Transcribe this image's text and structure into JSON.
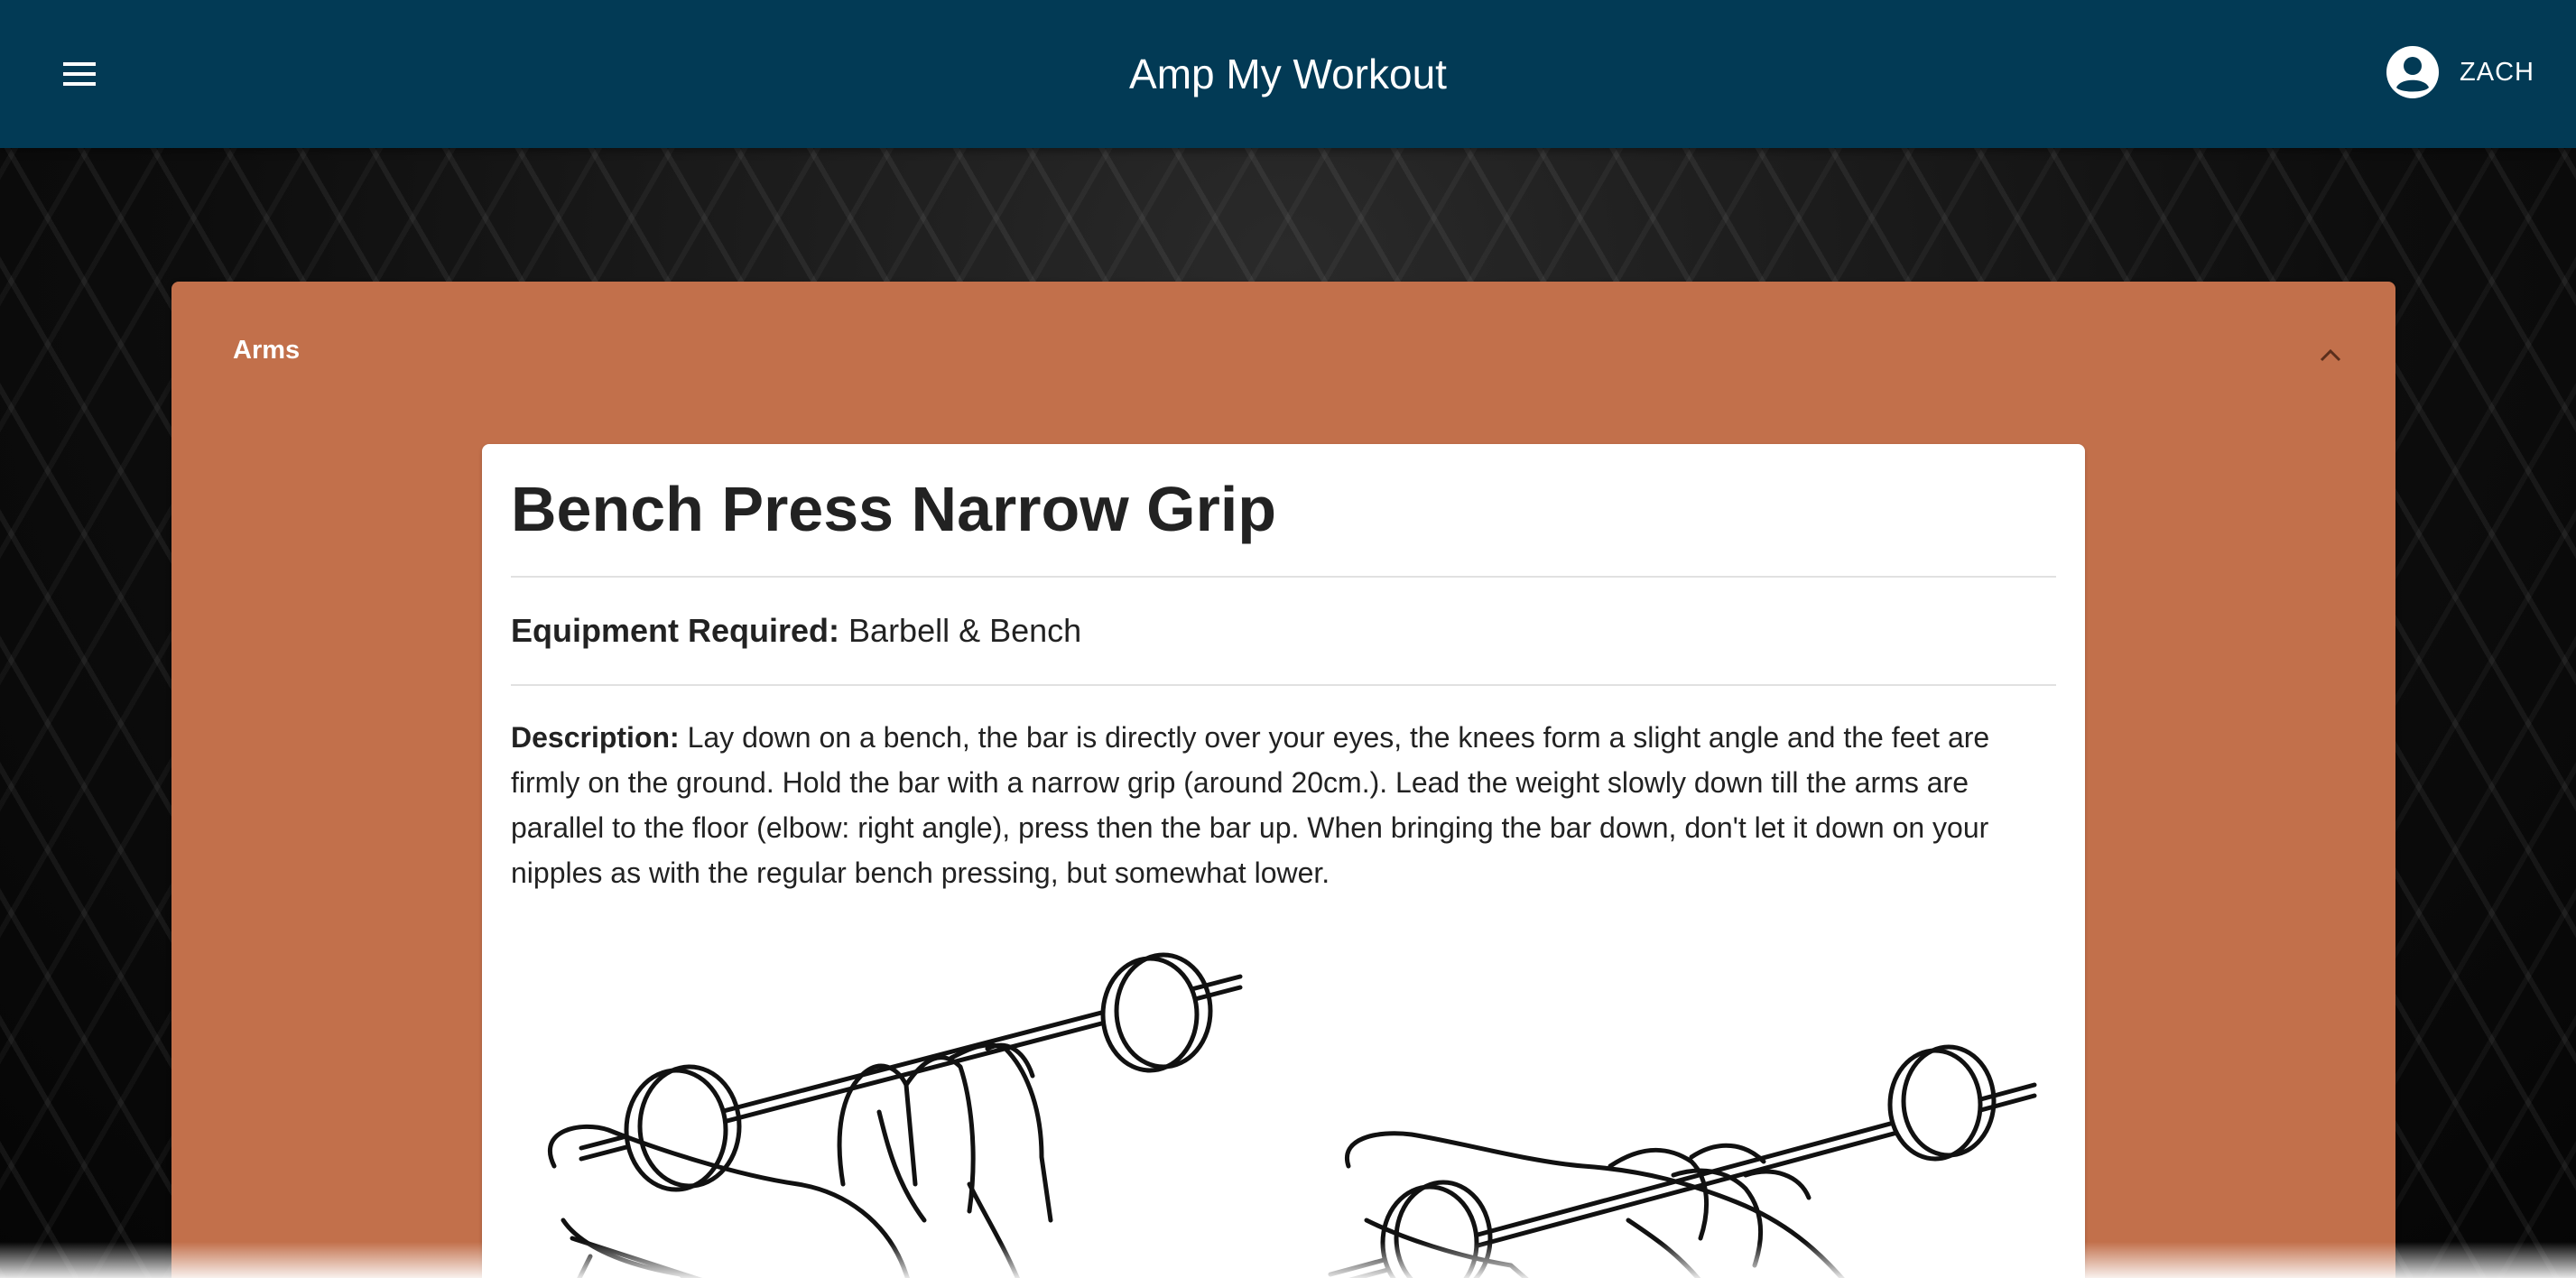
{
  "appbar": {
    "title": "Amp My Workout",
    "user_name": "ZACH",
    "menu_icon": "hamburger-menu-icon",
    "account_icon": "account-circle-icon",
    "color": "#023a55"
  },
  "panel": {
    "title": "Arms",
    "expanded": true,
    "toggle_icon": "chevron-up-icon",
    "color": "#c2704b"
  },
  "exercise": {
    "name": "Bench Press Narrow Grip",
    "equipment_label": "Equipment Required:",
    "equipment_value": "Barbell & Bench",
    "description_label": "Description:",
    "description_text": "Lay down on a bench, the bar is directly over your eyes, the knees form a slight angle and the feet are firmly on the ground. Hold the bar with a narrow grip (around 20cm.). Lead the weight slowly down till the arms are parallel to the floor (elbow: right angle), press then the bar up. When bringing the bar down, don't let it down on your nipples as with the regular bench pressing, but somewhat lower.",
    "images": [
      "bench-press-start-illustration",
      "bench-press-end-illustration"
    ]
  }
}
